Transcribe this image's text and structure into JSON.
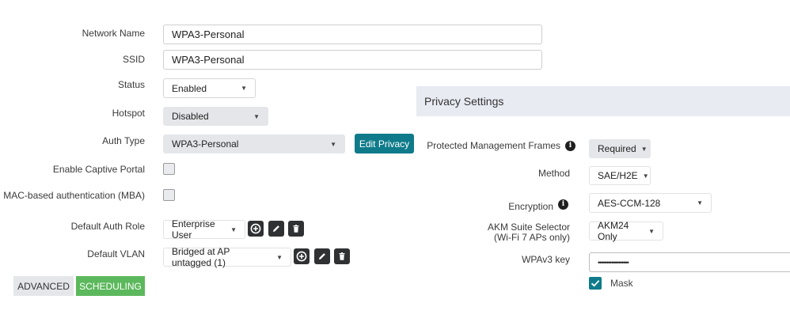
{
  "form": {
    "network_name": {
      "label": "Network Name",
      "value": "WPA3-Personal"
    },
    "ssid": {
      "label": "SSID",
      "value": "WPA3-Personal"
    },
    "status": {
      "label": "Status",
      "value": "Enabled"
    },
    "hotspot": {
      "label": "Hotspot",
      "value": "Disabled"
    },
    "auth_type": {
      "label": "Auth Type",
      "value": "WPA3-Personal",
      "edit_privacy": "Edit Privacy"
    },
    "captive_portal": {
      "label": "Enable Captive Portal"
    },
    "mba": {
      "label": "MAC-based authentication (MBA)"
    },
    "default_auth_role": {
      "label": "Default Auth Role",
      "value": "Enterprise User"
    },
    "default_vlan": {
      "label": "Default VLAN",
      "value": "Bridged at AP untagged (1)"
    }
  },
  "bottom_tabs": {
    "advanced": "ADVANCED",
    "scheduling": "SCHEDULING"
  },
  "privacy": {
    "title": "Privacy Settings",
    "pmf": {
      "label": "Protected Management Frames",
      "value": "Required"
    },
    "method": {
      "label": "Method",
      "value": "SAE/H2E"
    },
    "encryption": {
      "label": "Encryption",
      "value": "AES-CCM-128"
    },
    "akm": {
      "label_line1": "AKM Suite Selector",
      "label_line2": "(Wi-Fi 7 APs only)",
      "value": "AKM24 Only"
    },
    "wpa_key": {
      "label": "WPAv3 key",
      "value": "••••••••••••••••••"
    },
    "mask": {
      "label": "Mask",
      "checked": true
    }
  },
  "colors": {
    "teal": "#0f7b8a",
    "green": "#5cb85c",
    "panel": "#e8ebf2"
  }
}
